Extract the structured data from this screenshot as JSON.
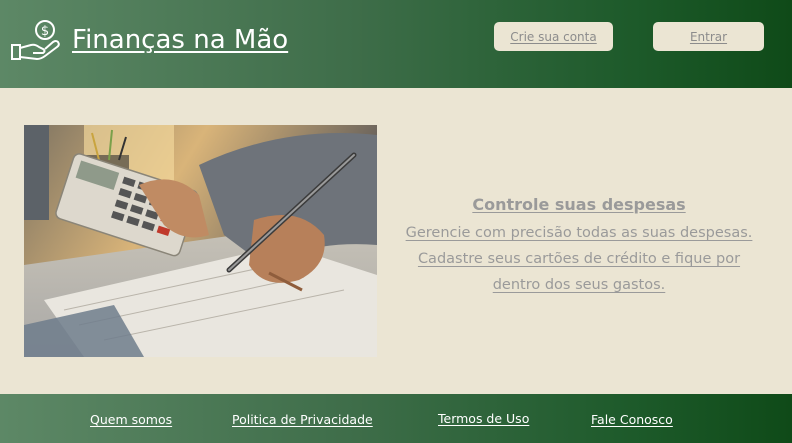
{
  "header": {
    "brand": "Finanças na Mão",
    "signup_label": "Crie sua conta",
    "login_label": "Entrar"
  },
  "feature": {
    "title": "Controle suas despesas",
    "text": "Gerencie com precisão todas as suas despesas. Cadastre seus cartões de crédito e fique por dentro dos seus gastos."
  },
  "footer": {
    "links": [
      "Quem somos",
      "Politica de Privacidade",
      "Termos de Uso",
      "Fale Conosco"
    ]
  },
  "icons": {
    "logo": "hand-money-icon",
    "logo_symbol": "$"
  },
  "colors": {
    "header_green_light": "#5d8866",
    "header_green_dark": "#0f4a18",
    "background": "#ebe5d3",
    "button_bg": "#ebe5d3",
    "button_text": "#8c8c8c",
    "feature_text": "#9a9a9a"
  }
}
